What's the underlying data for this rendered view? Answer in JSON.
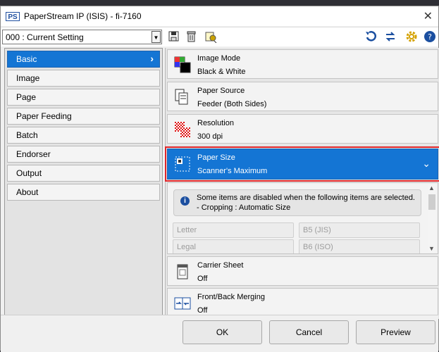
{
  "window": {
    "title": "PaperStream IP (ISIS) - fi-7160",
    "logo": "PS"
  },
  "toolbar": {
    "setting_value": "000 : Current Setting",
    "icons": [
      "save-icon",
      "delete-icon",
      "settings-file-icon",
      "reset-icon",
      "swap-icon",
      "gear-icon",
      "help-icon"
    ]
  },
  "sidebar": {
    "items": [
      {
        "label": "Basic",
        "active": true
      },
      {
        "label": "Image"
      },
      {
        "label": "Page"
      },
      {
        "label": "Paper Feeding"
      },
      {
        "label": "Batch"
      },
      {
        "label": "Endorser"
      },
      {
        "label": "Output"
      },
      {
        "label": "About"
      }
    ]
  },
  "panel": {
    "cards": [
      {
        "title": "Image Mode",
        "value": "Black & White"
      },
      {
        "title": "Paper Source",
        "value": "Feeder (Both Sides)"
      },
      {
        "title": "Resolution",
        "value": "300 dpi"
      },
      {
        "title": "Paper Size",
        "value": "Scanner's Maximum"
      },
      {
        "title": "Carrier Sheet",
        "value": "Off"
      },
      {
        "title": "Front/Back Merging",
        "value": "Off"
      }
    ],
    "info": {
      "line1": "Some items are disabled when the following items are selected.",
      "line2": "- Cropping : Automatic Size"
    },
    "size_options": [
      "Letter",
      "B5 (JIS)",
      "Legal",
      "B6 (ISO)"
    ]
  },
  "buttons": {
    "ok": "OK",
    "cancel": "Cancel",
    "preview": "Preview"
  },
  "colors": {
    "selected": "#1475d4",
    "highlight_border": "#e0262a",
    "accent": "#1b4fa0"
  }
}
